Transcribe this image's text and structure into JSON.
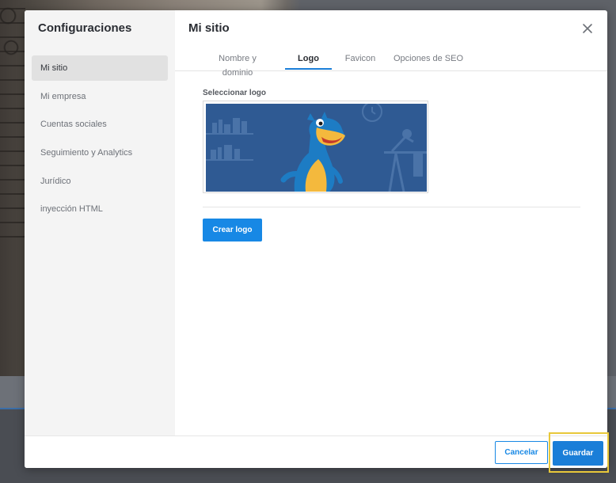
{
  "sidebar": {
    "title": "Configuraciones",
    "items": [
      {
        "label": "Mi sitio"
      },
      {
        "label": "Mi empresa"
      },
      {
        "label": "Cuentas sociales"
      },
      {
        "label": "Seguimiento y Analytics"
      },
      {
        "label": "Jurídico"
      },
      {
        "label": "inyección HTML"
      }
    ]
  },
  "main": {
    "title": "Mi sitio",
    "tabs": [
      {
        "label": "Nombre y dominio"
      },
      {
        "label": "Logo"
      },
      {
        "label": "Favicon"
      },
      {
        "label": "Opciones de SEO"
      }
    ],
    "active_tab": "Logo",
    "logo_label": "Seleccionar logo",
    "create_logo_label": "Crear logo"
  },
  "footer": {
    "cancel_label": "Cancelar",
    "save_label": "Guardar"
  },
  "colors": {
    "accent": "#1788e5",
    "highlight": "#e8c83a",
    "logo_background": "#2f5a93"
  },
  "icons": {
    "close": "close-icon",
    "logo_image": "hostgator-mascot-image"
  }
}
